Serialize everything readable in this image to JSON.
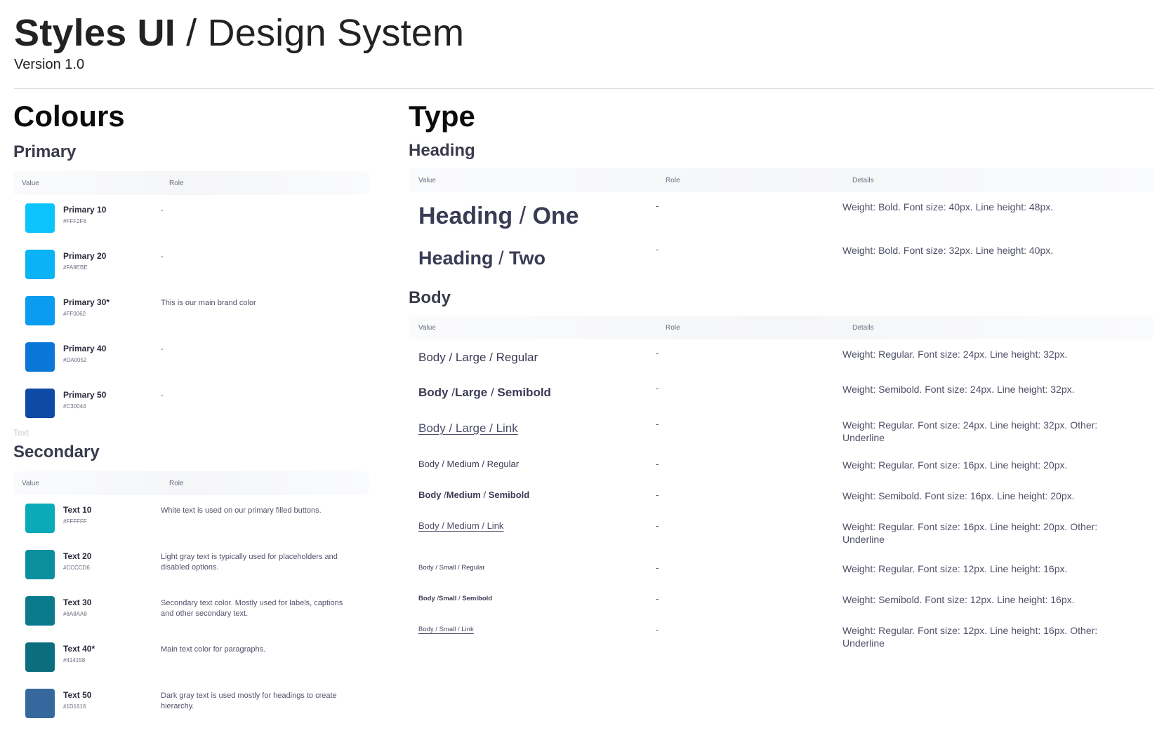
{
  "header": {
    "title_strong": "Styles UI",
    "title_rest": " / Design System",
    "version": "Version 1.0"
  },
  "colours": {
    "title": "Colours",
    "primary": {
      "title": "Primary",
      "head_value": "Value",
      "head_role": "Role",
      "rows": [
        {
          "name": "Primary 10",
          "hex": "#FFF2F6",
          "role": "-",
          "color": "#0cc4fb"
        },
        {
          "name": "Primary 20",
          "hex": "#FA9EBE",
          "role": "-",
          "color": "#0bb2f6"
        },
        {
          "name": "Primary 30*",
          "hex": "#FF0062",
          "role": "This is our main brand color",
          "color": "#0a9cee"
        },
        {
          "name": "Primary 40",
          "hex": "#DA0052",
          "role": "-",
          "color": "#0a76d5"
        },
        {
          "name": "Primary 50",
          "hex": "#C30044",
          "role": "-",
          "color": "#0f4aa4"
        }
      ]
    },
    "muted_label": "Text",
    "secondary": {
      "title": "Secondary",
      "head_value": "Value",
      "head_role": "Role",
      "rows": [
        {
          "name": "Text 10",
          "hex": "#FFFFFF",
          "role": "White text is used on our primary filled buttons.",
          "color": "#0aaab8"
        },
        {
          "name": "Text 20",
          "hex": "#CCCCD6",
          "role": "Light gray text is typically used for placeholders and disabled options.",
          "color": "#0b8f9f"
        },
        {
          "name": "Text 30",
          "hex": "#8A8AA8",
          "role": "Secondary text color. Mostly used for labels, captions and other secondary text.",
          "color": "#0a7b8c"
        },
        {
          "name": "Text 40*",
          "hex": "#414158",
          "role": "Main text color for paragraphs.",
          "color": "#0b6e7e"
        },
        {
          "name": "Text 50",
          "hex": "#1D1616",
          "role": "Dark gray text is used mostly for headings to create hierarchy.",
          "color": "#36689e"
        }
      ]
    }
  },
  "type": {
    "title": "Type",
    "heading": {
      "title": "Heading",
      "head_value": "Value",
      "head_role": "Role",
      "head_details": "Details",
      "rows": [
        {
          "a": "Heading",
          "b": "One",
          "role": "-",
          "details": "Weight: Bold. Font size: 40px. Line height: 48px."
        },
        {
          "a": "Heading",
          "b": "Two",
          "role": "-",
          "details": "Weight: Bold. Font size: 32px. Line height: 40px."
        }
      ]
    },
    "body": {
      "title": "Body",
      "head_value": "Value",
      "head_role": "Role",
      "head_details": "Details",
      "rows": [
        {
          "a": "Body",
          "b": "Large",
          "c": "Regular",
          "role": "-",
          "details": "Weight: Regular. Font size: 24px. Line height: 32px."
        },
        {
          "a": "Body",
          "b": "Large",
          "c": "Semibold",
          "role": "-",
          "details": "Weight: Semibold. Font size: 24px. Line height: 32px."
        },
        {
          "a": "Body",
          "b": "Large",
          "c": "Link",
          "role": "-",
          "details": "Weight: Regular. Font size: 24px. Line height: 32px. Other: Underline"
        },
        {
          "a": "Body",
          "b": "Medium",
          "c": "Regular",
          "role": "-",
          "details": "Weight: Regular. Font size: 16px. Line height: 20px."
        },
        {
          "a": "Body",
          "b": "Medium",
          "c": "Semibold",
          "role": "-",
          "details": "Weight: Semibold. Font size: 16px. Line height: 20px."
        },
        {
          "a": "Body",
          "b": "Medium",
          "c": "Link",
          "role": "-",
          "details": "Weight: Regular. Font size: 16px. Line height: 20px. Other: Underline"
        },
        {
          "a": "Body",
          "b": "Small",
          "c": "Regular",
          "role": "-",
          "details": "Weight: Regular. Font size: 12px. Line height: 16px."
        },
        {
          "a": "Body",
          "b": "Small",
          "c": "Semibold",
          "role": "-",
          "details": "Weight: Semibold. Font size: 12px. Line height: 16px."
        },
        {
          "a": "Body",
          "b": "Small",
          "c": "Link",
          "role": "-",
          "details": "Weight: Regular. Font size: 12px. Line height: 16px.  Other: Underline"
        }
      ]
    }
  }
}
